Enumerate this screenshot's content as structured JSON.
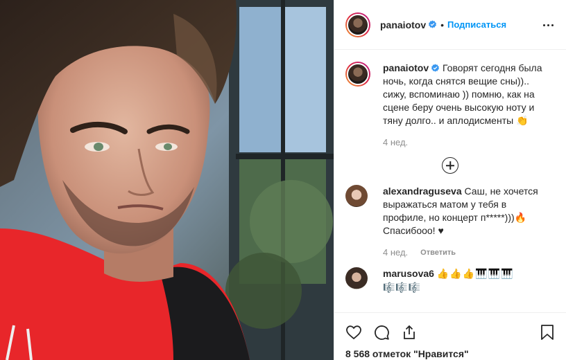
{
  "header": {
    "username": "panaiotov",
    "separator": "•",
    "follow_label": "Подписаться"
  },
  "caption": {
    "username": "panaiotov",
    "text": "Говорят сегодня была ночь, когда снятся вещие сны)).. сижу, вспоминаю )) помню, как на сцене беру очень высокую ноту и тяну долго.. и аплодисменты 👏",
    "time": "4 нед."
  },
  "comments": [
    {
      "username": "alexandraguseva",
      "text": "Саш, не хочется выражаться матом у тебя в профиле, но концерт п*****)))🔥 Спасибооо! ♥",
      "time": "4 нед.",
      "reply_label": "Ответить"
    },
    {
      "username": "marusova6",
      "text": "👍👍👍🎹🎹🎹",
      "text2": "🎼🎼🎼"
    }
  ],
  "actions": {
    "likes": "8 568 отметок \"Нравится\""
  },
  "icons": {
    "verified": "verified-badge-icon",
    "more": "more-options-icon",
    "load_more": "plus-circle-icon",
    "like": "heart-icon",
    "comment": "comment-bubble-icon",
    "share": "share-icon",
    "save": "bookmark-icon"
  },
  "colors": {
    "link": "#0095f6",
    "verified": "#3897f0",
    "hoodie": "#e8262a"
  }
}
